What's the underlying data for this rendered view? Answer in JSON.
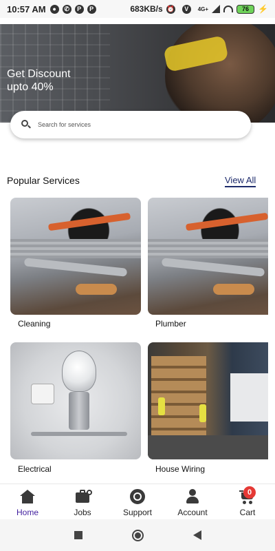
{
  "status_bar": {
    "time": "10:57 AM",
    "speed": "683KB/s",
    "network": "4G+",
    "battery": "76"
  },
  "banner": {
    "line1": "Get Discount",
    "line2": "upto 40%"
  },
  "search": {
    "placeholder": "Search for services"
  },
  "section": {
    "title": "Popular Services",
    "view_all": "View All"
  },
  "services": [
    {
      "label": "Cleaning",
      "image": "tools-photo"
    },
    {
      "label": "Plumber",
      "image": "tools-photo"
    },
    {
      "label": "Electrical",
      "image": "robot-bulb-photo"
    },
    {
      "label": "House Wiring",
      "image": "warehouse-photo"
    }
  ],
  "bottom_nav": {
    "items": [
      {
        "label": "Home",
        "icon": "home-icon",
        "active": true
      },
      {
        "label": "Jobs",
        "icon": "jobs-icon",
        "active": false
      },
      {
        "label": "Support",
        "icon": "support-icon",
        "active": false
      },
      {
        "label": "Account",
        "icon": "account-icon",
        "active": false
      },
      {
        "label": "Cart",
        "icon": "cart-icon",
        "active": false
      }
    ],
    "cart_count": "0"
  },
  "colors": {
    "active_nav": "#3f1d9e",
    "view_all": "#1d2a6b",
    "badge": "#e53935"
  }
}
